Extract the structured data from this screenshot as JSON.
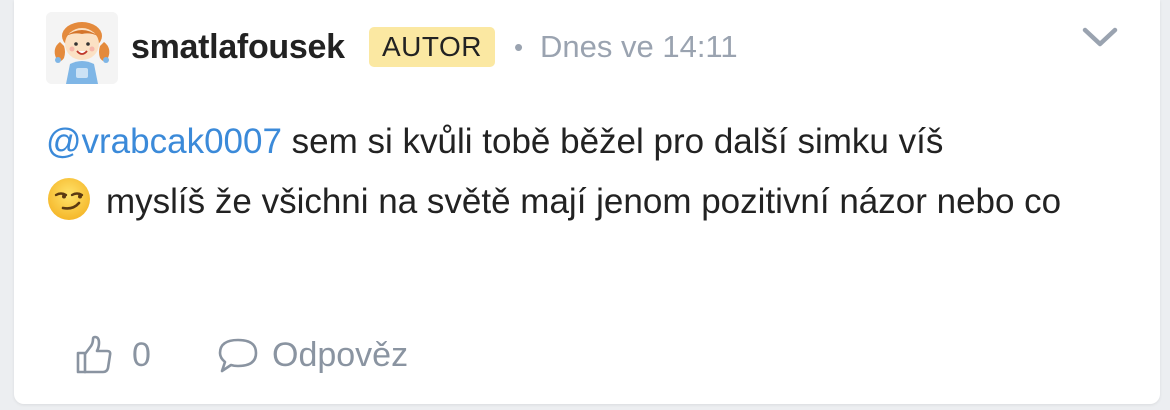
{
  "comment": {
    "author": {
      "username": "smatlafousek",
      "badge": "AUTOR",
      "avatar_icon": "cartoon-girl-avatar"
    },
    "separator": "•",
    "timestamp": "Dnes ve 14:11",
    "menu_icon": "chevron-down-icon",
    "body": {
      "mention": "@vrabcak0007",
      "text_1": " sem si kvůli tobě běžel pro další simku víš",
      "emoji": "smirking-face-emoji",
      "text_2": "myslíš že všichni na světě mají jenom pozitivní názor nebo co"
    },
    "actions": {
      "like_icon": "thumbs-up-icon",
      "like_count": "0",
      "reply_icon": "speech-bubble-icon",
      "reply_label": "Odpověz"
    }
  },
  "colors": {
    "mention": "#3b8ad9",
    "badge_bg": "#fbe8a2",
    "muted": "#9aa3b0",
    "text": "#222222"
  }
}
